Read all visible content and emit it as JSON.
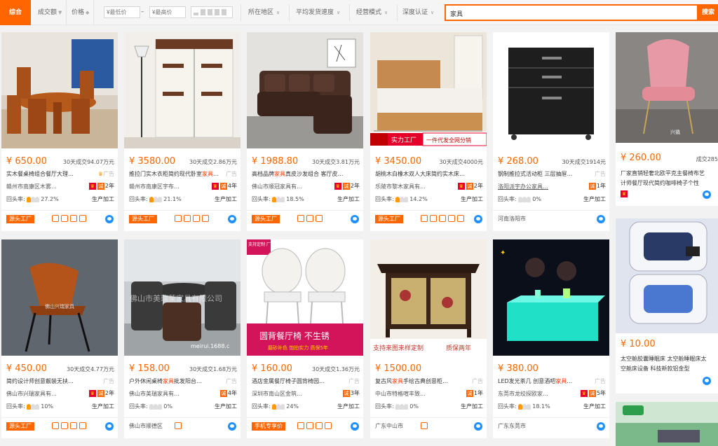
{
  "filters": {
    "active": "综合",
    "sort_volume": "成交额",
    "sort_price": "价格",
    "price_min_placeholder": "¥最低价",
    "price_dash": "–",
    "price_max_placeholder": "¥最高价",
    "region": "所在地区",
    "shipping": "平均发货速度",
    "mode": "经营模式",
    "depth": "深度认证",
    "search_value": "家具",
    "search_button": "搜索"
  },
  "products": [
    {
      "price": "¥ 650.00",
      "sales": "30天成交94.07万元",
      "title_a": "实木餐桌椅组合餐厅大理…",
      "title_em": "",
      "title_b": "",
      "ad": "广告",
      "seller": "赣州市南康区木雾…",
      "years": "2年",
      "repeat": "回头率:",
      "pct": "27.2%",
      "model": "生产加工",
      "foot_tag": "源头工厂",
      "foot_loc": ""
    },
    {
      "price": "¥ 3580.00",
      "sales": "30天成交2.86万元",
      "title_a": "推拉门实木衣柜简约现代卧室",
      "title_em": "家具",
      "title_b": "…",
      "ad": "广告",
      "seller": "赣州市南康区宇布…",
      "years": "4年",
      "repeat": "回头率:",
      "pct": "21.1%",
      "model": "生产加工",
      "foot_tag": "源头工厂",
      "foot_loc": ""
    },
    {
      "price": "¥ 1988.80",
      "sales": "30天成交3.81万元",
      "title_a": "高档品牌",
      "title_em": "家具",
      "title_b": "真皮沙发组合 客厅皮…",
      "ad": "",
      "seller": "佛山市顺冠家具有…",
      "years": "2年",
      "repeat": "回头率:",
      "pct": "18.5%",
      "model": "生产加工",
      "foot_tag": "源头工厂",
      "foot_loc": ""
    },
    {
      "price": "¥ 3450.00",
      "sales": "30天成交4000元",
      "title_a": "胡桃木白橡木双人大床简约实木床…",
      "title_em": "",
      "title_b": "",
      "ad": "",
      "seller": "乐陵市黎木家具有…",
      "years": "2年",
      "repeat": "回头率:",
      "pct": "14.2%",
      "model": "生产加工",
      "foot_tag": "源头工厂",
      "foot_loc": ""
    },
    {
      "price": "¥ 268.00",
      "sales": "30天成交1914元",
      "title_a": "钢制推拉式活动柜 三层抽屉…",
      "title_em": "",
      "title_b": "",
      "ad": "广告",
      "seller": "洛阳派宇办公家具…",
      "years": "1年",
      "repeat": "回头率:",
      "pct": "0%",
      "model": "生产加工",
      "foot_tag": "",
      "foot_loc": "河南洛阳市"
    },
    {
      "price": "¥ 260.00",
      "sales": "成交285",
      "title_a": "厂家直销轻奢北欧平克主餐椅布艺",
      "title_em": "",
      "title_b": "",
      "title2": "计师餐厅现代简约咖啡椅子个性",
      "ad": "",
      "seller": "",
      "years": "",
      "repeat": "",
      "pct": "",
      "model": "",
      "foot_tag": "",
      "foot_loc": ""
    },
    {
      "price": "¥ 450.00",
      "sales": "30天成交4.77万元",
      "title_a": "简约设计师创意靓装无扶…",
      "title_em": "",
      "title_b": "",
      "ad": "广告",
      "seller": "佛山市兴瑞家具有…",
      "years": "2年",
      "repeat": "回头率:",
      "pct": "10%",
      "model": "生产加工",
      "foot_tag": "源头工厂",
      "foot_loc": ""
    },
    {
      "price": "¥ 158.00",
      "sales": "30天成交1.68万元",
      "title_a": "户外休闲桌椅",
      "title_em": "家具",
      "title_b": "批发阳台…",
      "ad": "广告",
      "seller": "佛山市美瑞家具有…",
      "years": "4年",
      "repeat": "回头率:",
      "pct": "0%",
      "model": "生产加工",
      "foot_tag": "",
      "foot_loc": "佛山市顺德区"
    },
    {
      "price": "¥ 160.00",
      "sales": "30天成交1.36万元",
      "title_a": "酒店金属餐厅椅子圆背椅园…",
      "title_em": "",
      "title_b": "",
      "ad": "广告",
      "seller": "深圳市南山区金筑…",
      "years": "3年",
      "repeat": "回头率:",
      "pct": "24%",
      "model": "生产加工",
      "foot_tag": "手机专享价",
      "foot_loc": ""
    },
    {
      "price": "¥ 1500.00",
      "sales": "",
      "title_a": "复古风",
      "title_em": "家具",
      "title_b": "手绘古典创意柜…",
      "ad": "广告",
      "seller": "中山市特格喧丰致…",
      "years": "1年",
      "repeat": "回头率:",
      "pct": "0%",
      "model": "生产加工",
      "foot_tag": "",
      "foot_loc": "广东中山市"
    },
    {
      "price": "¥ 380.00",
      "sales": "",
      "title_a": "LED发光茶几 创意酒吧",
      "title_em": "家具",
      "title_b": "…",
      "ad": "广告",
      "seller": "东莞市龙绞探欧家…",
      "years": "5年",
      "repeat": "回头率:",
      "pct": "18.1%",
      "model": "生产加工",
      "foot_tag": "",
      "foot_loc": "广东东莞市"
    },
    {
      "price": "¥ 10.00",
      "sales": "",
      "title_a": "太空舱胶囊睡眠床 太空舱睡眠床太",
      "title_em": "",
      "title_b": "",
      "title2": "空舱床设备 科技新款铝金型",
      "ad": "",
      "seller": "",
      "years": "",
      "repeat": "",
      "pct": "",
      "model": "",
      "foot_tag": "",
      "foot_loc": ""
    }
  ],
  "image_texts": {
    "bed_banner_left": "实力工厂",
    "bed_banner_right": "一件代发全网分销",
    "wm_xingrui": "佛山兴瑞家具",
    "wm_meirui_big": "佛山市美瑞莱家具有限公司",
    "wm_meirui_small": "meirui.1688.c",
    "chair_tag": "支持定制 厂家生产",
    "chair_banner": "圆背餐厅椅 不生锈",
    "chair_sub": "磨砂补色 饱拍实力 质保5年",
    "cabinet_banner_left": "支持来图来样定制",
    "cabinet_banner_right": "质保两年",
    "pink_logo": "兴撬"
  },
  "colors": {
    "accent": "#ff6600",
    "ad_text": "#bbbbbb",
    "title_highlight": "#ff3300"
  }
}
